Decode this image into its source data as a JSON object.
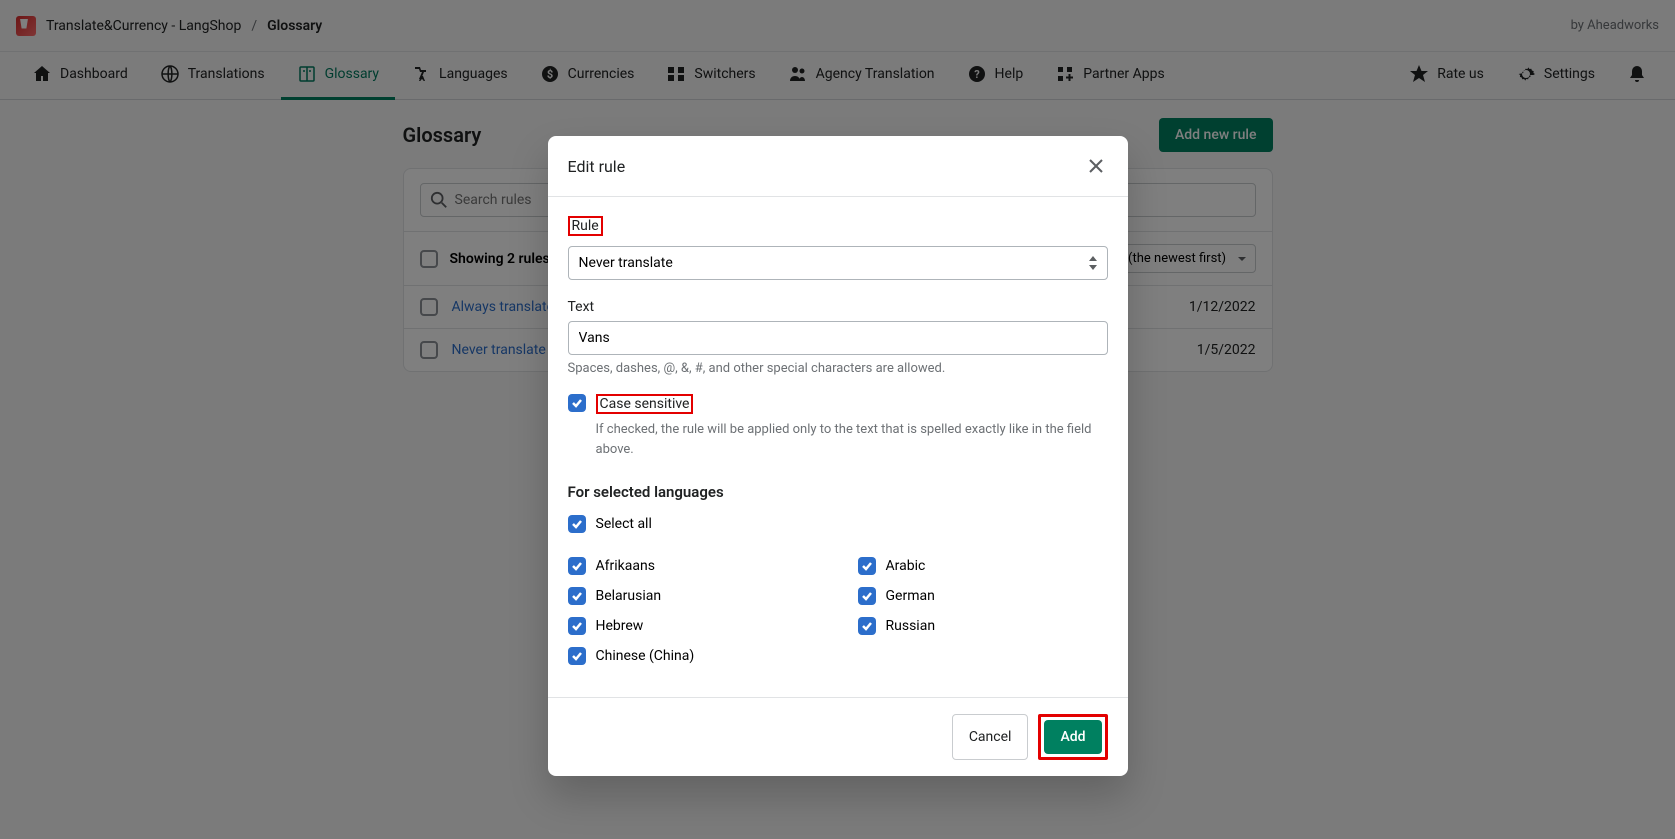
{
  "header": {
    "app_name": "Translate&Currency - LangShop",
    "page": "Glossary",
    "byline": "by Aheadworks"
  },
  "nav": {
    "items": [
      "Dashboard",
      "Translations",
      "Glossary",
      "Languages",
      "Currencies",
      "Switchers",
      "Agency Translation",
      "Help",
      "Partner Apps"
    ],
    "right": [
      "Rate us",
      "Settings"
    ]
  },
  "page": {
    "title": "Glossary",
    "add_button": "Add new rule",
    "search_placeholder": "Search rules",
    "showing_text": "Showing 2 rules",
    "sort_text": "d (the newest first)",
    "rows": [
      {
        "label": "Always translate",
        "date": "1/12/2022"
      },
      {
        "label": "Never translate",
        "date": "1/5/2022"
      }
    ]
  },
  "modal": {
    "title": "Edit rule",
    "rule_label": "Rule",
    "rule_value": "Never translate",
    "text_label": "Text",
    "text_value": "Vans",
    "text_hint": "Spaces, dashes, @, &, #, and other special characters are allowed.",
    "case_label": "Case sensitive",
    "case_hint": "If checked, the rule will be applied only to the text that is spelled exactly like in the field above.",
    "lang_section": "For selected languages",
    "select_all": "Select all",
    "langs_left": [
      "Afrikaans",
      "Belarusian",
      "Hebrew",
      "Chinese (China)"
    ],
    "langs_right": [
      "Arabic",
      "German",
      "Russian"
    ],
    "cancel": "Cancel",
    "add": "Add"
  }
}
